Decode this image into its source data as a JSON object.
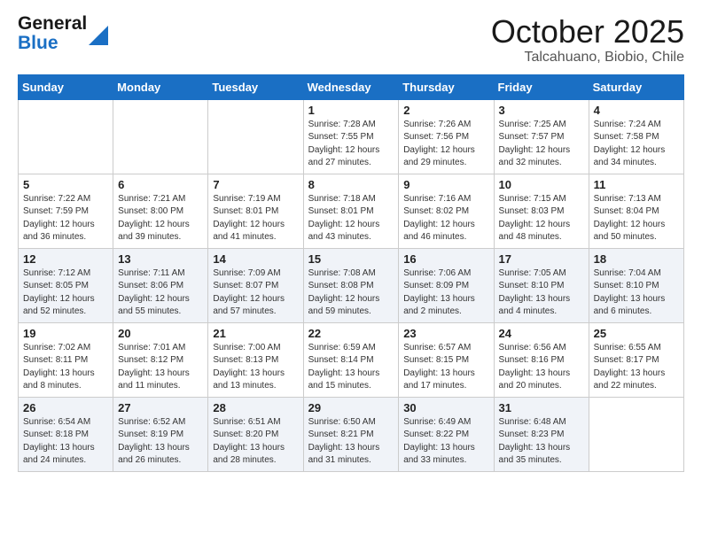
{
  "logo": {
    "line1": "General",
    "line2": "Blue"
  },
  "title": "October 2025",
  "subtitle": "Talcahuano, Biobio, Chile",
  "headers": [
    "Sunday",
    "Monday",
    "Tuesday",
    "Wednesday",
    "Thursday",
    "Friday",
    "Saturday"
  ],
  "weeks": [
    [
      {
        "day": "",
        "info": ""
      },
      {
        "day": "",
        "info": ""
      },
      {
        "day": "",
        "info": ""
      },
      {
        "day": "1",
        "info": "Sunrise: 7:28 AM\nSunset: 7:55 PM\nDaylight: 12 hours\nand 27 minutes."
      },
      {
        "day": "2",
        "info": "Sunrise: 7:26 AM\nSunset: 7:56 PM\nDaylight: 12 hours\nand 29 minutes."
      },
      {
        "day": "3",
        "info": "Sunrise: 7:25 AM\nSunset: 7:57 PM\nDaylight: 12 hours\nand 32 minutes."
      },
      {
        "day": "4",
        "info": "Sunrise: 7:24 AM\nSunset: 7:58 PM\nDaylight: 12 hours\nand 34 minutes."
      }
    ],
    [
      {
        "day": "5",
        "info": "Sunrise: 7:22 AM\nSunset: 7:59 PM\nDaylight: 12 hours\nand 36 minutes."
      },
      {
        "day": "6",
        "info": "Sunrise: 7:21 AM\nSunset: 8:00 PM\nDaylight: 12 hours\nand 39 minutes."
      },
      {
        "day": "7",
        "info": "Sunrise: 7:19 AM\nSunset: 8:01 PM\nDaylight: 12 hours\nand 41 minutes."
      },
      {
        "day": "8",
        "info": "Sunrise: 7:18 AM\nSunset: 8:01 PM\nDaylight: 12 hours\nand 43 minutes."
      },
      {
        "day": "9",
        "info": "Sunrise: 7:16 AM\nSunset: 8:02 PM\nDaylight: 12 hours\nand 46 minutes."
      },
      {
        "day": "10",
        "info": "Sunrise: 7:15 AM\nSunset: 8:03 PM\nDaylight: 12 hours\nand 48 minutes."
      },
      {
        "day": "11",
        "info": "Sunrise: 7:13 AM\nSunset: 8:04 PM\nDaylight: 12 hours\nand 50 minutes."
      }
    ],
    [
      {
        "day": "12",
        "info": "Sunrise: 7:12 AM\nSunset: 8:05 PM\nDaylight: 12 hours\nand 52 minutes."
      },
      {
        "day": "13",
        "info": "Sunrise: 7:11 AM\nSunset: 8:06 PM\nDaylight: 12 hours\nand 55 minutes."
      },
      {
        "day": "14",
        "info": "Sunrise: 7:09 AM\nSunset: 8:07 PM\nDaylight: 12 hours\nand 57 minutes."
      },
      {
        "day": "15",
        "info": "Sunrise: 7:08 AM\nSunset: 8:08 PM\nDaylight: 12 hours\nand 59 minutes."
      },
      {
        "day": "16",
        "info": "Sunrise: 7:06 AM\nSunset: 8:09 PM\nDaylight: 13 hours\nand 2 minutes."
      },
      {
        "day": "17",
        "info": "Sunrise: 7:05 AM\nSunset: 8:10 PM\nDaylight: 13 hours\nand 4 minutes."
      },
      {
        "day": "18",
        "info": "Sunrise: 7:04 AM\nSunset: 8:10 PM\nDaylight: 13 hours\nand 6 minutes."
      }
    ],
    [
      {
        "day": "19",
        "info": "Sunrise: 7:02 AM\nSunset: 8:11 PM\nDaylight: 13 hours\nand 8 minutes."
      },
      {
        "day": "20",
        "info": "Sunrise: 7:01 AM\nSunset: 8:12 PM\nDaylight: 13 hours\nand 11 minutes."
      },
      {
        "day": "21",
        "info": "Sunrise: 7:00 AM\nSunset: 8:13 PM\nDaylight: 13 hours\nand 13 minutes."
      },
      {
        "day": "22",
        "info": "Sunrise: 6:59 AM\nSunset: 8:14 PM\nDaylight: 13 hours\nand 15 minutes."
      },
      {
        "day": "23",
        "info": "Sunrise: 6:57 AM\nSunset: 8:15 PM\nDaylight: 13 hours\nand 17 minutes."
      },
      {
        "day": "24",
        "info": "Sunrise: 6:56 AM\nSunset: 8:16 PM\nDaylight: 13 hours\nand 20 minutes."
      },
      {
        "day": "25",
        "info": "Sunrise: 6:55 AM\nSunset: 8:17 PM\nDaylight: 13 hours\nand 22 minutes."
      }
    ],
    [
      {
        "day": "26",
        "info": "Sunrise: 6:54 AM\nSunset: 8:18 PM\nDaylight: 13 hours\nand 24 minutes."
      },
      {
        "day": "27",
        "info": "Sunrise: 6:52 AM\nSunset: 8:19 PM\nDaylight: 13 hours\nand 26 minutes."
      },
      {
        "day": "28",
        "info": "Sunrise: 6:51 AM\nSunset: 8:20 PM\nDaylight: 13 hours\nand 28 minutes."
      },
      {
        "day": "29",
        "info": "Sunrise: 6:50 AM\nSunset: 8:21 PM\nDaylight: 13 hours\nand 31 minutes."
      },
      {
        "day": "30",
        "info": "Sunrise: 6:49 AM\nSunset: 8:22 PM\nDaylight: 13 hours\nand 33 minutes."
      },
      {
        "day": "31",
        "info": "Sunrise: 6:48 AM\nSunset: 8:23 PM\nDaylight: 13 hours\nand 35 minutes."
      },
      {
        "day": "",
        "info": ""
      }
    ]
  ]
}
